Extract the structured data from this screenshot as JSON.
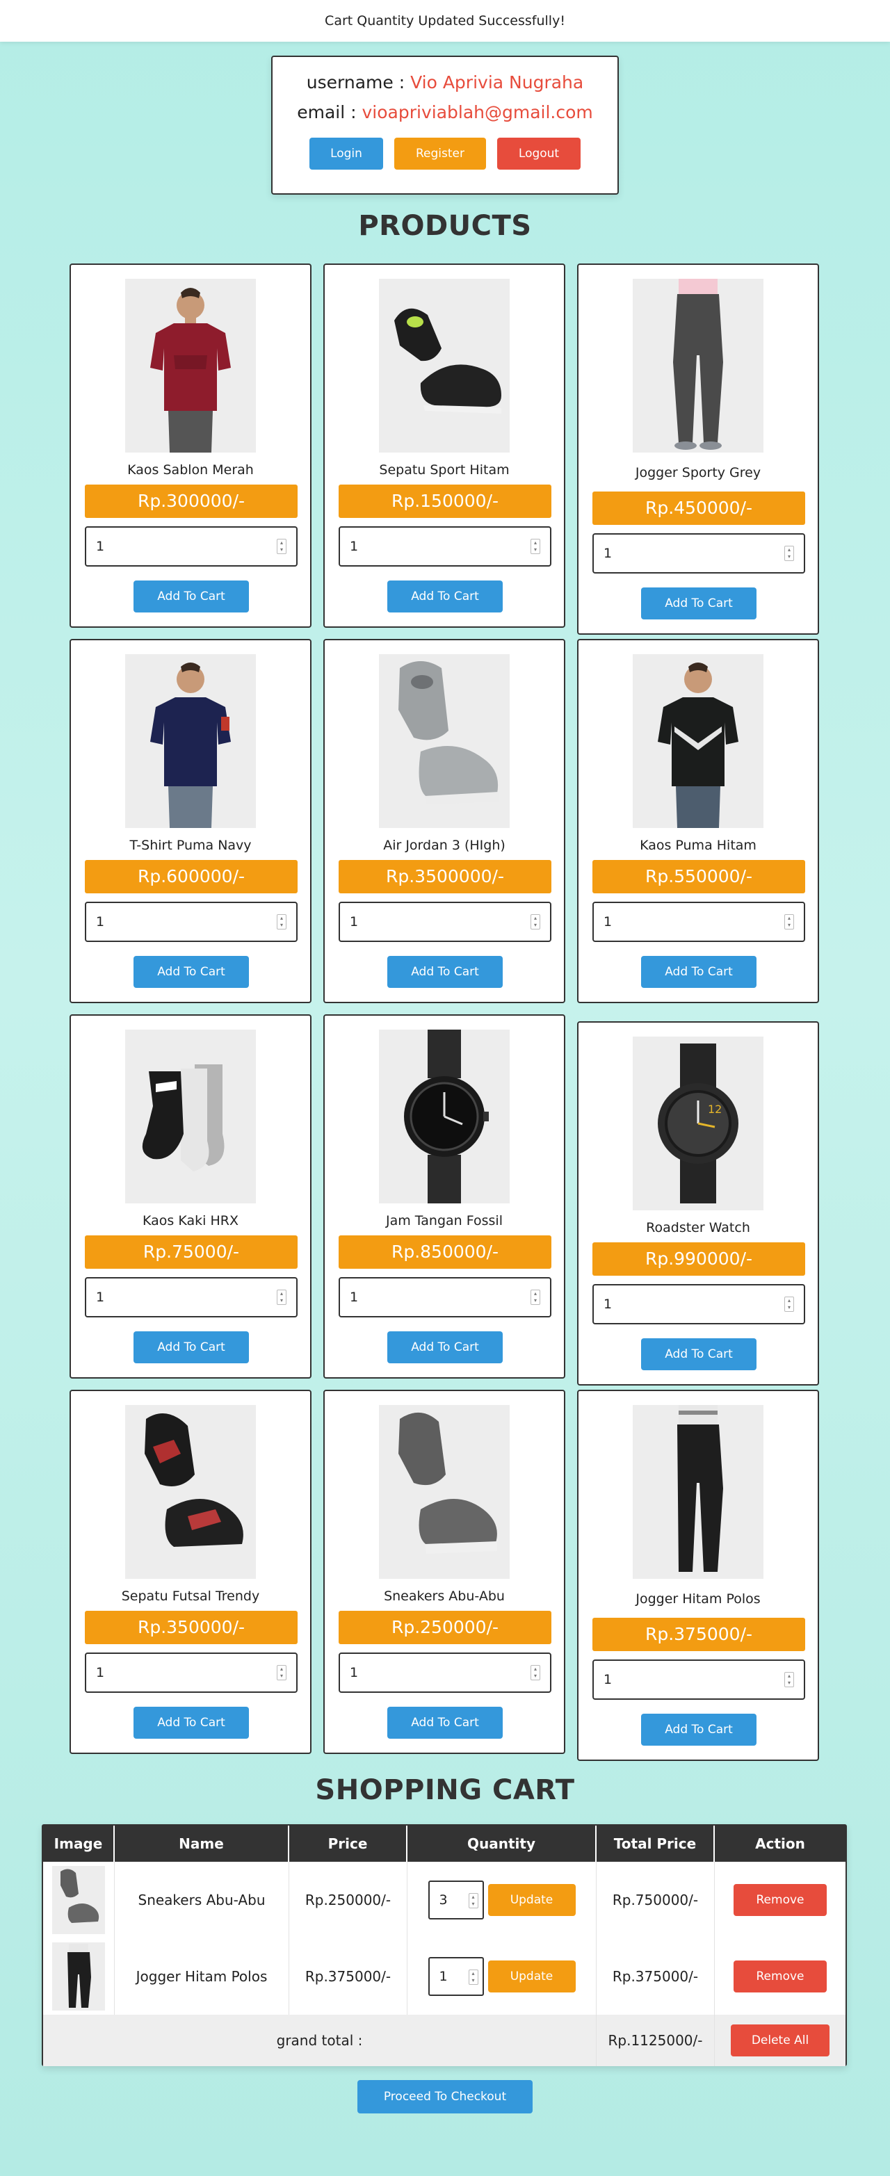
{
  "message": "Cart Quantity Updated Successfully!",
  "user": {
    "username_label": "username :",
    "username": "Vio Aprivia Nugraha",
    "email_label": "email :",
    "email": "vioapriviablah@gmail.com",
    "login": "Login",
    "register": "Register",
    "logout": "Logout"
  },
  "products_heading": "PRODUCTS",
  "add_label": "Add To Cart",
  "products": [
    {
      "name": "Kaos Sablon Merah",
      "price": "Rp.300000/-",
      "qty": "1"
    },
    {
      "name": "Sepatu Sport Hitam",
      "price": "Rp.150000/-",
      "qty": "1"
    },
    {
      "name": "Jogger Sporty Grey",
      "price": "Rp.450000/-",
      "qty": "1"
    },
    {
      "name": "T-Shirt Puma Navy",
      "price": "Rp.600000/-",
      "qty": "1"
    },
    {
      "name": "Air Jordan 3 (HIgh)",
      "price": "Rp.3500000/-",
      "qty": "1"
    },
    {
      "name": "Kaos Puma Hitam",
      "price": "Rp.550000/-",
      "qty": "1"
    },
    {
      "name": "Kaos Kaki HRX",
      "price": "Rp.75000/-",
      "qty": "1"
    },
    {
      "name": "Jam Tangan Fossil",
      "price": "Rp.850000/-",
      "qty": "1"
    },
    {
      "name": "Roadster Watch",
      "price": "Rp.990000/-",
      "qty": "1"
    },
    {
      "name": "Sepatu Futsal Trendy",
      "price": "Rp.350000/-",
      "qty": "1"
    },
    {
      "name": "Sneakers Abu-Abu",
      "price": "Rp.250000/-",
      "qty": "1"
    },
    {
      "name": "Jogger Hitam Polos",
      "price": "Rp.375000/-",
      "qty": "1"
    }
  ],
  "cart_heading": "SHOPPING CART",
  "cart": {
    "headers": [
      "Image",
      "Name",
      "Price",
      "Quantity",
      "Total Price",
      "Action"
    ],
    "rows": [
      {
        "name": "Sneakers Abu-Abu",
        "price": "Rp.250000/-",
        "qty": "3",
        "total": "Rp.750000/-"
      },
      {
        "name": "Jogger Hitam Polos",
        "price": "Rp.375000/-",
        "qty": "1",
        "total": "Rp.375000/-"
      }
    ],
    "update_label": "Update",
    "remove_label": "Remove",
    "grand_total_label": "grand total :",
    "grand_total": "Rp.1125000/-",
    "delete_all": "Delete All"
  },
  "checkout": "Proceed To Checkout",
  "colors": {
    "accent_blue": "#3498db",
    "accent_orange": "#f39c12",
    "accent_red": "#e74c3c",
    "background": "#b4ede6"
  }
}
